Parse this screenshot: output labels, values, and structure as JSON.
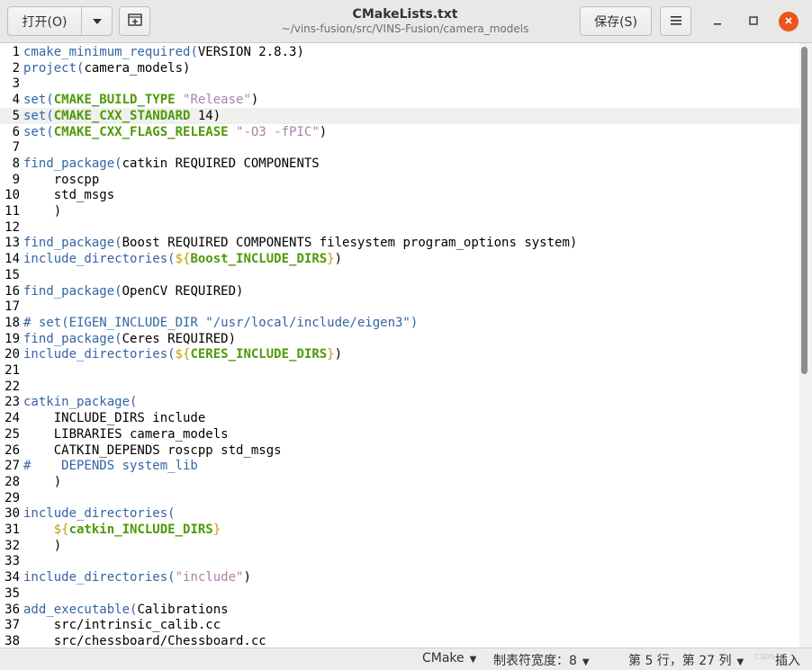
{
  "header": {
    "open_label": "打开(O)",
    "open_menu_icon": "triangle-down-icon",
    "new_tab_icon": "new-tab-icon",
    "title": "CMakeLists.txt",
    "subtitle": "~/vins-fusion/src/VINS-Fusion/camera_models",
    "save_label": "保存(S)",
    "menu_icon": "hamburger-icon",
    "minimize_icon": "minimize-icon",
    "maximize_icon": "maximize-icon",
    "close_icon": "close-icon"
  },
  "editor": {
    "current_line": 5,
    "lines": [
      {
        "n": "1",
        "text": "cmake_minimum_required(VERSION 2.8.3)"
      },
      {
        "n": "2",
        "text": "project(camera_models)"
      },
      {
        "n": "3",
        "text": ""
      },
      {
        "n": "4",
        "text": "set(CMAKE_BUILD_TYPE \"Release\")"
      },
      {
        "n": "5",
        "text": "set(CMAKE_CXX_STANDARD 14)"
      },
      {
        "n": "6",
        "text": "set(CMAKE_CXX_FLAGS_RELEASE \"-O3 -fPIC\")"
      },
      {
        "n": "7",
        "text": ""
      },
      {
        "n": "8",
        "text": "find_package(catkin REQUIRED COMPONENTS"
      },
      {
        "n": "9",
        "text": "    roscpp"
      },
      {
        "n": "10",
        "text": "    std_msgs"
      },
      {
        "n": "11",
        "text": "    )"
      },
      {
        "n": "12",
        "text": ""
      },
      {
        "n": "13",
        "text": "find_package(Boost REQUIRED COMPONENTS filesystem program_options system)"
      },
      {
        "n": "14",
        "text": "include_directories(${Boost_INCLUDE_DIRS})"
      },
      {
        "n": "15",
        "text": ""
      },
      {
        "n": "16",
        "text": "find_package(OpenCV REQUIRED)"
      },
      {
        "n": "17",
        "text": ""
      },
      {
        "n": "18",
        "text": "# set(EIGEN_INCLUDE_DIR \"/usr/local/include/eigen3\")"
      },
      {
        "n": "19",
        "text": "find_package(Ceres REQUIRED)"
      },
      {
        "n": "20",
        "text": "include_directories(${CERES_INCLUDE_DIRS})"
      },
      {
        "n": "21",
        "text": ""
      },
      {
        "n": "22",
        "text": ""
      },
      {
        "n": "23",
        "text": "catkin_package("
      },
      {
        "n": "24",
        "text": "    INCLUDE_DIRS include"
      },
      {
        "n": "25",
        "text": "    LIBRARIES camera_models"
      },
      {
        "n": "26",
        "text": "    CATKIN_DEPENDS roscpp std_msgs"
      },
      {
        "n": "27",
        "text": "#    DEPENDS system_lib"
      },
      {
        "n": "28",
        "text": "    )"
      },
      {
        "n": "29",
        "text": ""
      },
      {
        "n": "30",
        "text": "include_directories("
      },
      {
        "n": "31",
        "text": "    ${catkin_INCLUDE_DIRS}"
      },
      {
        "n": "32",
        "text": "    )"
      },
      {
        "n": "33",
        "text": ""
      },
      {
        "n": "34",
        "text": "include_directories(\"include\")"
      },
      {
        "n": "35",
        "text": ""
      },
      {
        "n": "36",
        "text": "add_executable(Calibrations"
      },
      {
        "n": "37",
        "text": "    src/intrinsic_calib.cc"
      },
      {
        "n": "38",
        "text": "    src/chessboard/Chessboard.cc"
      }
    ]
  },
  "statusbar": {
    "language": "CMake",
    "tab_width": "制表符宽度：8",
    "position": "第 5 行，第 27 列",
    "insert_mode": "插入",
    "dropdown_icon": "triangle-down-icon",
    "watermark": "CSDN"
  },
  "colors": {
    "function": "#3465a4",
    "keyword": "#4e9a06",
    "string": "#ad7fa8",
    "close_button": "#e95420",
    "current_line": "#f0f0ee"
  }
}
